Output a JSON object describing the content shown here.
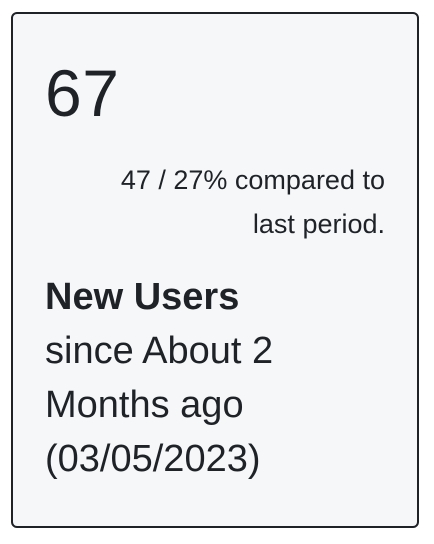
{
  "card": {
    "value": "67",
    "comparison_line1": "47 / 27% compared to",
    "comparison_line2": "last period.",
    "title_bold": "New Users",
    "title_line2": "since About 2",
    "title_line3": "Months ago",
    "title_line4": "(03/05/2023)"
  }
}
